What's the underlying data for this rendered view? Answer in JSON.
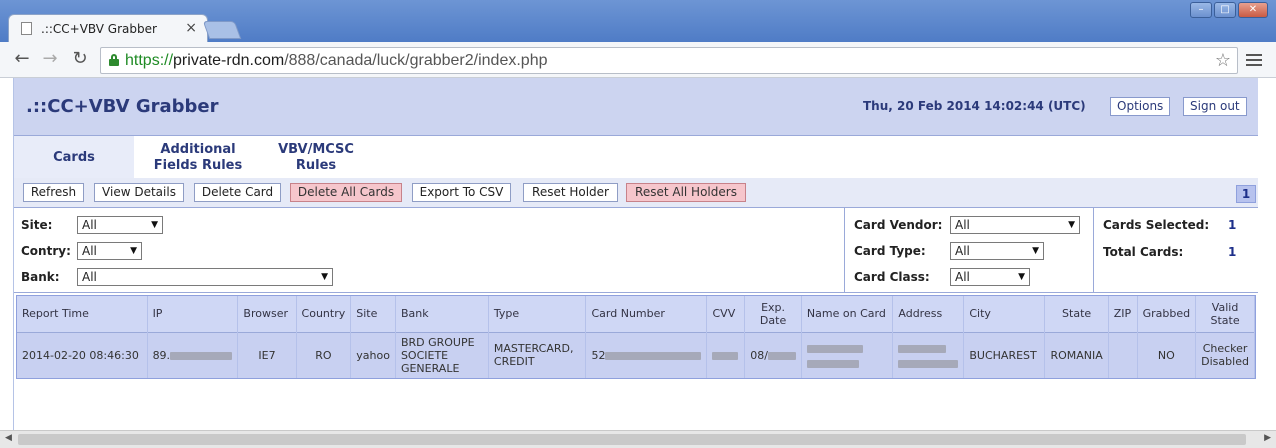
{
  "browser": {
    "tab_title": ".::CC+VBV Grabber",
    "tab_close": "×",
    "url_scheme": "https://",
    "url_host": "private-rdn.com",
    "url_path": "/888/canada/luck/grabber2/index.php",
    "back_glyph": "←",
    "forward_glyph": "→",
    "reload_glyph": "↻",
    "star_glyph": "☆",
    "win_minimize": "–",
    "win_maximize": "□",
    "win_close": "✕"
  },
  "header": {
    "title": ".::CC+VBV Grabber",
    "datetime": "Thu, 20 Feb 2014 14:02:44 (UTC)",
    "options_label": "Options",
    "signout_label": "Sign out"
  },
  "tabs": [
    {
      "label": "Cards"
    },
    {
      "label": "Additional Fields Rules"
    },
    {
      "label": "VBV/MCSC Rules"
    }
  ],
  "actions": {
    "refresh": "Refresh",
    "view_details": "View Details",
    "delete_card": "Delete Card",
    "delete_all_cards": "Delete All Cards",
    "export_csv": "Export To CSV",
    "reset_holder": "Reset Holder",
    "reset_all_holders": "Reset All Holders",
    "page": "1"
  },
  "filters": {
    "site_label": "Site:",
    "site_value": "All",
    "contry_label": "Contry:",
    "contry_value": "All",
    "bank_label": "Bank:",
    "bank_value": "All",
    "vendor_label": "Card Vendor:",
    "vendor_value": "All",
    "type_label": "Card Type:",
    "type_value": "All",
    "class_label": "Card Class:",
    "class_value": "All"
  },
  "stats": {
    "selected_label": "Cards Selected:",
    "selected_value": "1",
    "total_label": "Total Cards:",
    "total_value": "1"
  },
  "table": {
    "headers": {
      "report_time": "Report Time",
      "ip": "IP",
      "browser": "Browser",
      "country": "Country",
      "site": "Site",
      "bank": "Bank",
      "type": "Type",
      "card_number": "Card Number",
      "cvv": "CVV",
      "exp_date": "Exp. Date",
      "name_on_card": "Name on Card",
      "address": "Address",
      "city": "City",
      "state": "State",
      "zip": "ZIP",
      "grabbed": "Grabbed",
      "valid_state": "Valid State"
    },
    "row": {
      "report_time": "2014-02-20 08:46:30",
      "ip_prefix": "89.",
      "browser": "IE7",
      "country": "RO",
      "site": "yahoo",
      "bank": "BRD GROUPE SOCIETE GENERALE",
      "type": "MASTERCARD, CREDIT",
      "card_prefix": "52",
      "exp_prefix": "08/",
      "city": "BUCHAREST",
      "state": "ROMANIA",
      "grabbed": "NO",
      "valid_state": "Checker Disabled"
    }
  },
  "colors": {
    "header_bg": "#ccd4f0",
    "accent_text": "#2b3a7a",
    "danger_btn": "#f6c6cc"
  }
}
